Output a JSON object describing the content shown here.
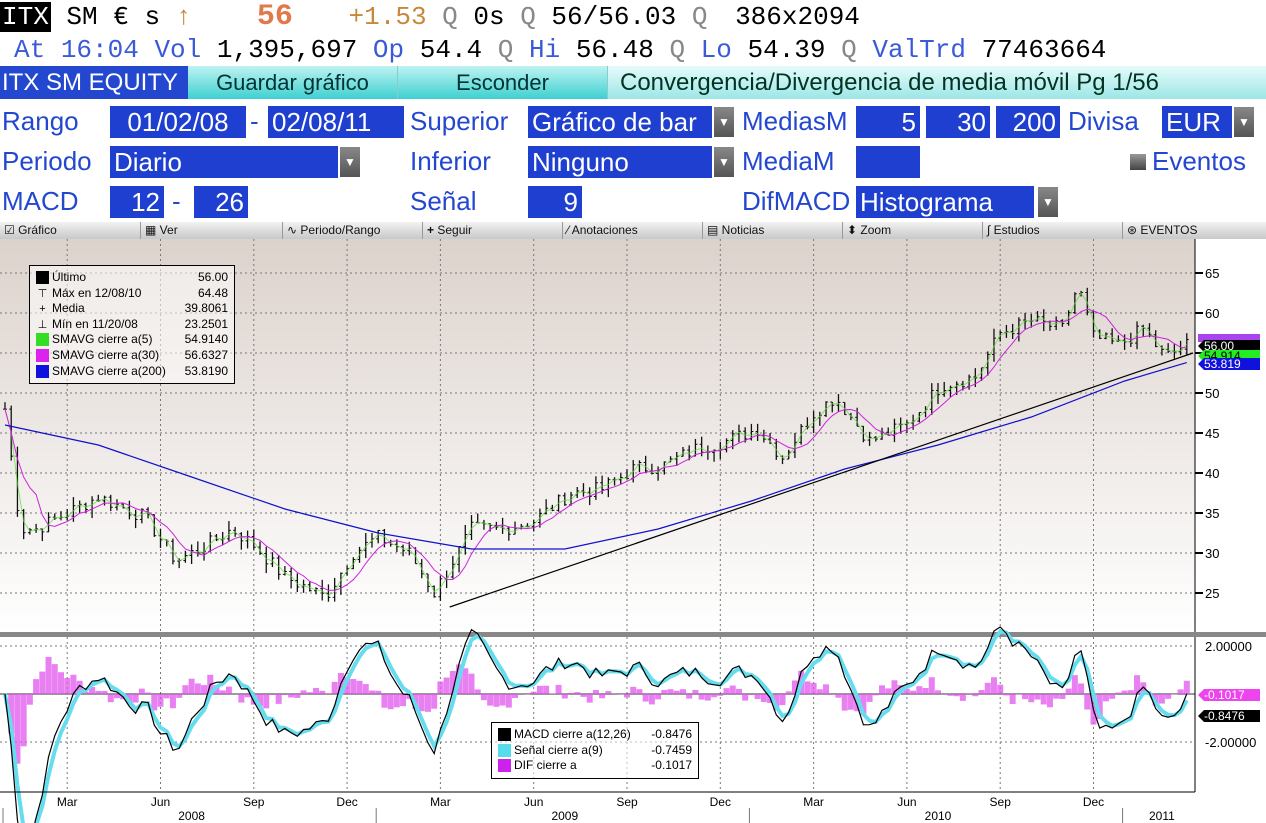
{
  "quote": {
    "ticker": "ITX",
    "exch": "SM",
    "currency": "€",
    "flag": "s",
    "arrow": "↑",
    "last": "56",
    "change": "+1.53",
    "q1": "Q",
    "time_s": "0s",
    "q2": "Q",
    "bidask": "56/56.03",
    "q3": "Q",
    "size": "386x2094"
  },
  "quote2": {
    "at_label": "At",
    "time": "16:04",
    "vol_label": "Vol",
    "vol": "1,395,697",
    "op_label": "Op",
    "op": "54.4",
    "q": "Q",
    "hi_label": "Hi",
    "hi": "56.48",
    "lo_label": "Lo",
    "lo": "54.39",
    "valtrd_label": "ValTrd",
    "valtrd": "77463664"
  },
  "tabs": {
    "security": "ITX SM EQUITY",
    "save": "Guardar gráfico",
    "hide": "Esconder",
    "title": "Convergencia/Divergencia de media móvil  Pg 1/56"
  },
  "settings": {
    "rango_label": "Rango",
    "from": "01/02/08",
    "dash": "-",
    "to": "02/08/11",
    "superior_label": "Superior",
    "superior": "Gráfico de bar",
    "medias_label": "MediasM",
    "m1": "5",
    "m2": "30",
    "m3": "200",
    "divisa_label": "Divisa",
    "divisa": "EUR",
    "periodo_label": "Periodo",
    "periodo": "Diario",
    "inferior_label": "Inferior",
    "inferior": "Ninguno",
    "media_label": "MediaM",
    "media": "",
    "eventos": "Eventos",
    "macd_label": "MACD",
    "macd1": "12",
    "macd2": "26",
    "senal_label": "Señal",
    "senal": "9",
    "dif_label": "DifMACD",
    "dif": "Histograma"
  },
  "toolbar": [
    "Gráfico",
    "Ver",
    "Periodo/Rango",
    "Seguir",
    "Anotaciones",
    "Noticias",
    "Zoom",
    "Estudios",
    "EVENTOS"
  ],
  "legend": [
    {
      "label": "Último",
      "value": "56.00",
      "color": "#000000"
    },
    {
      "label": "Máx en 12/08/10",
      "value": "64.48",
      "color": ""
    },
    {
      "label": "Media",
      "value": "39.8061",
      "color": ""
    },
    {
      "label": "Mín en 11/20/08",
      "value": "23.2501",
      "color": ""
    },
    {
      "label": "SMAVG cierre a(5)",
      "value": "54.9140",
      "color": "#33dd22"
    },
    {
      "label": "SMAVG cierre a(30)",
      "value": "56.6327",
      "color": "#dd22ee"
    },
    {
      "label": "SMAVG cierre a(200)",
      "value": "53.8190",
      "color": "#1111dd"
    }
  ],
  "macd_legend": [
    {
      "label": "MACD cierre a(12,26)",
      "value": "-0.8476",
      "color": "#000000"
    },
    {
      "label": "Señal cierre a(9)",
      "value": "-0.7459",
      "color": "#55ddee"
    },
    {
      "label": "DIF cierre a",
      "value": "-0.1017",
      "color": "#cc22ee"
    }
  ],
  "tags": {
    "last": "56.00",
    "sma5": "54.914",
    "sma200": "53.819",
    "dif": "-0.1017",
    "macd": "-0.8476"
  },
  "chart_data": {
    "type": "bar",
    "price_axis": {
      "ylim": [
        20,
        68
      ],
      "ticks": [
        "25",
        "30",
        "35",
        "40",
        "45",
        "50",
        "55",
        "60",
        "65"
      ]
    },
    "macd_axis": {
      "ylim": [
        -4.3,
        2.3
      ],
      "ticks": [
        "2.00000",
        "-2.00000"
      ]
    },
    "months": [
      "Mar",
      "Jun",
      "Sep",
      "Dec",
      "Mar",
      "Jun",
      "Sep",
      "Dec",
      "Mar",
      "Jun",
      "Sep",
      "Dec"
    ],
    "month_index": [
      2,
      5,
      8,
      11,
      14,
      17,
      20,
      23,
      26,
      29,
      32,
      35
    ],
    "years": [
      "2008",
      "2009",
      "2010",
      "2011"
    ],
    "price_monthly": {
      "m": [
        0,
        0.5,
        1,
        2,
        3,
        4.5,
        5.5,
        6.5,
        7.3,
        8,
        9,
        10.3,
        11.2,
        12,
        13,
        13.8,
        15,
        16,
        17,
        18.2,
        19.2,
        20.2,
        21.2,
        22.2,
        23.2,
        24.2,
        25,
        26,
        26.7,
        27.8,
        29,
        30.1,
        31.2,
        32,
        33,
        34,
        34.5,
        35,
        35.8,
        36.6,
        37.3,
        38
      ],
      "close": [
        48,
        33,
        33,
        35,
        37,
        34.5,
        29,
        31,
        33,
        31,
        27,
        24.5,
        30,
        32,
        30,
        25,
        33,
        33,
        34,
        37.5,
        38,
        40.5,
        41,
        43,
        44,
        45.5,
        42,
        47.5,
        49.5,
        44,
        46,
        51,
        52,
        57.5,
        59,
        58,
        63.5,
        57,
        56,
        58,
        54.5,
        56
      ]
    },
    "sma200": {
      "m": [
        0,
        3,
        6,
        9,
        12,
        15,
        18,
        21,
        24,
        27,
        30,
        33,
        36,
        38
      ],
      "value": [
        46,
        43.5,
        39.5,
        35.5,
        32.5,
        30.5,
        30.5,
        33,
        36.5,
        40.5,
        43.5,
        47,
        51.5,
        53.8
      ]
    },
    "trendline": {
      "from": {
        "m": 14.3,
        "value": 23.25
      },
      "to": {
        "m": 38.2,
        "value": 55
      }
    }
  }
}
